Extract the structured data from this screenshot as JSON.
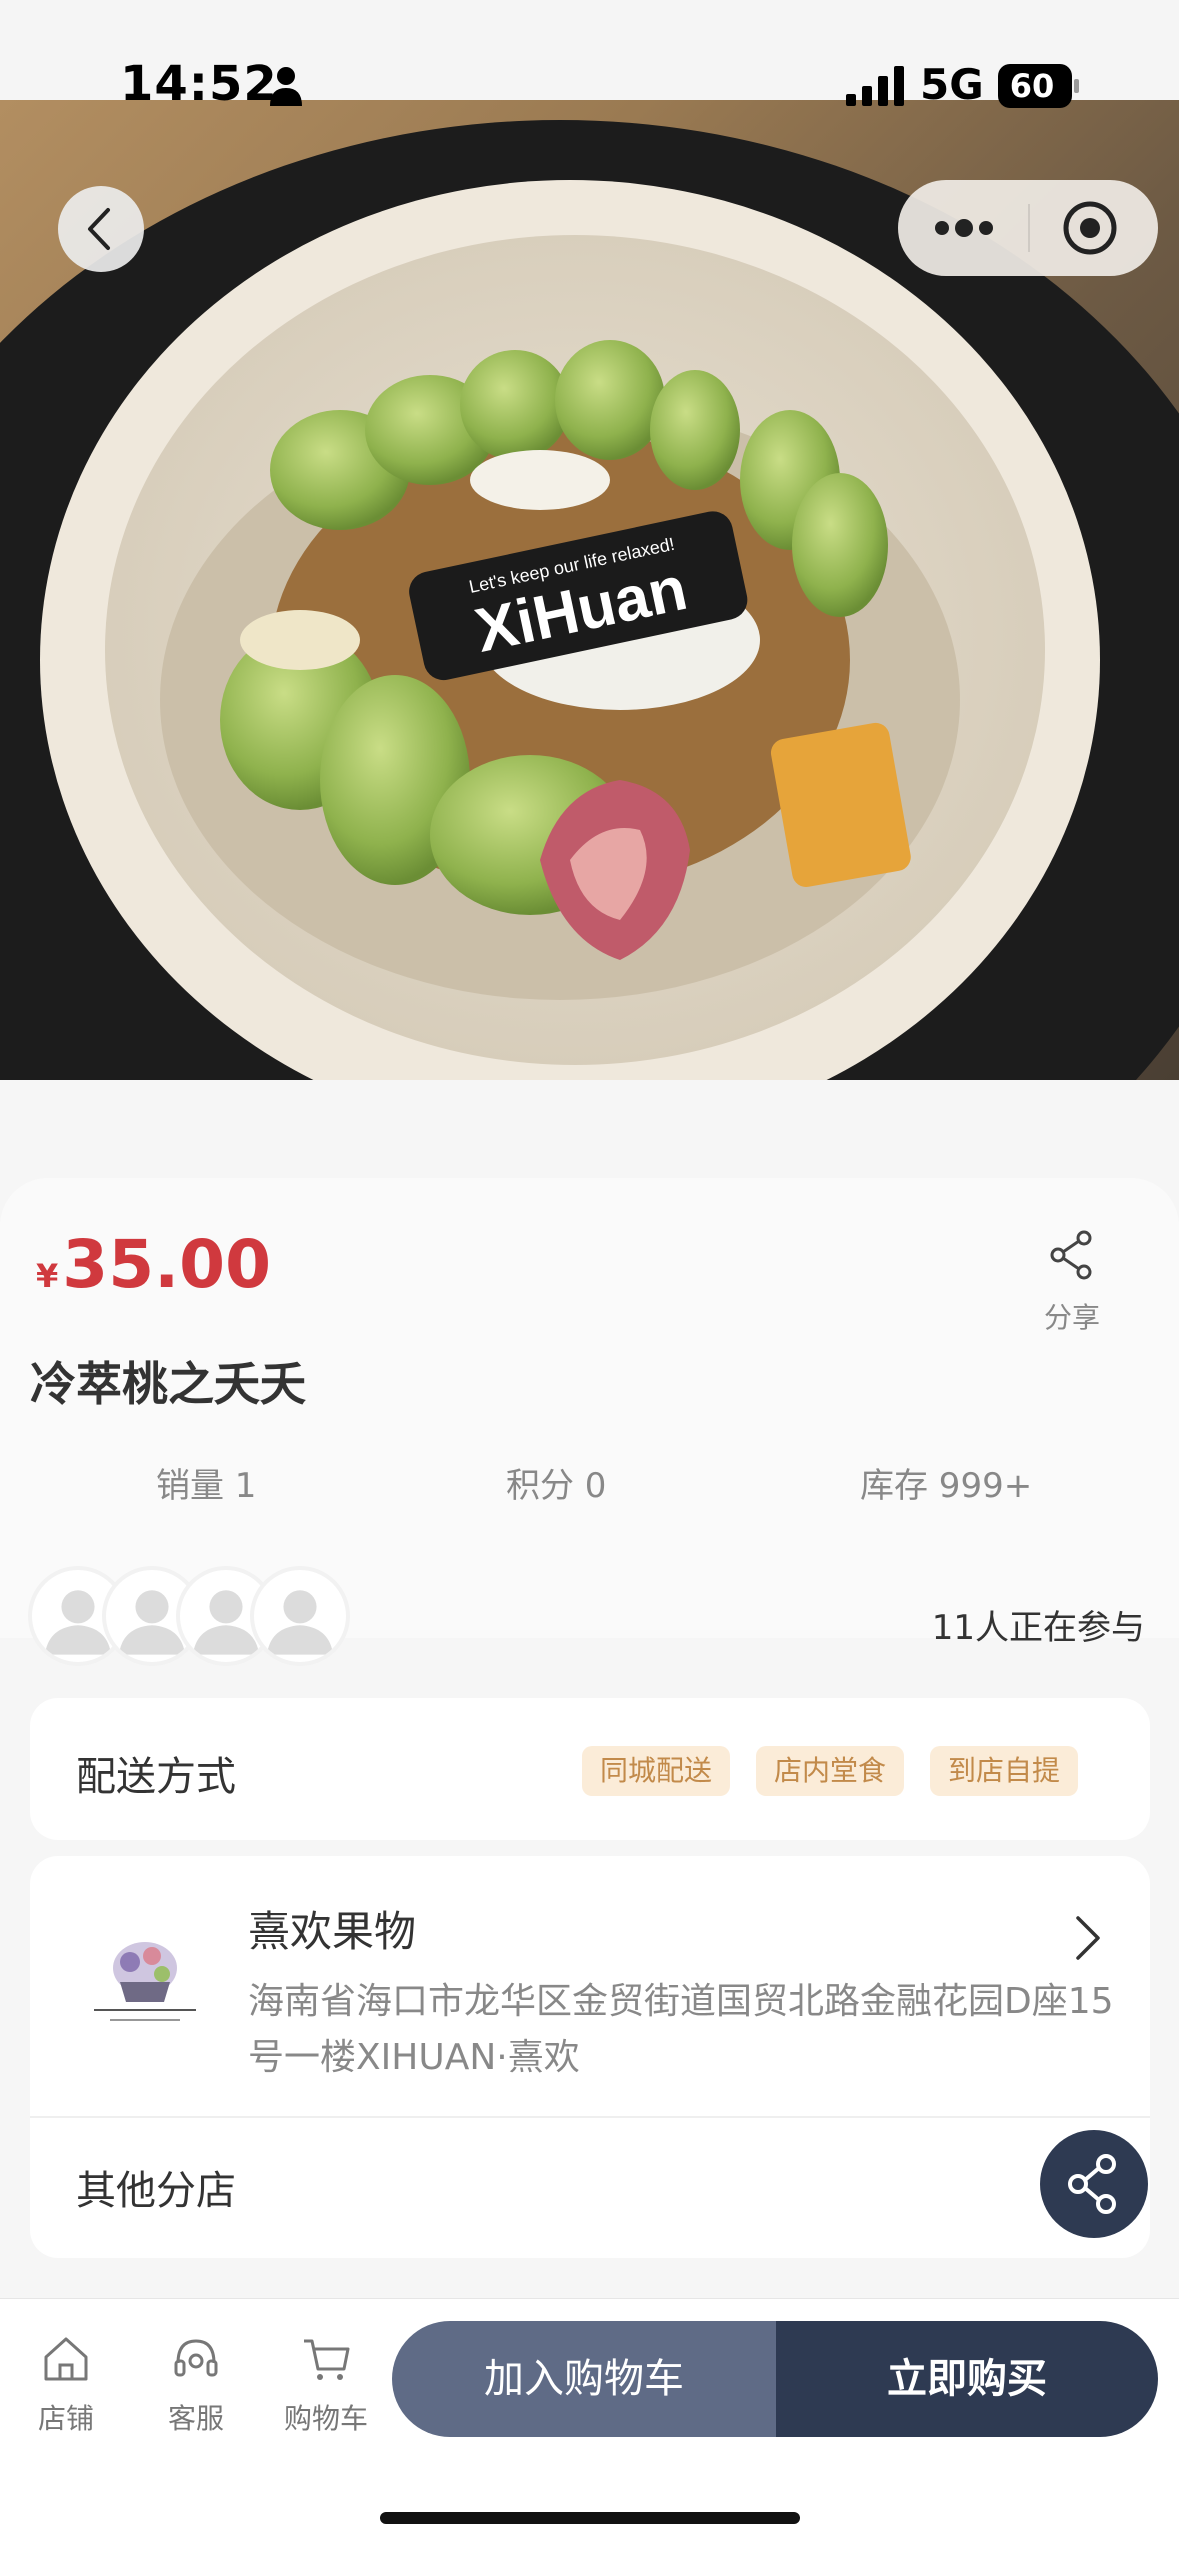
{
  "status_bar": {
    "time": "14:52",
    "network": "5G",
    "battery": "60"
  },
  "hero": {
    "image": "fruit-bowl-photo",
    "bowl_logo_text": "XiHuan",
    "bowl_logo_subtext": "Let's keep our life relaxed!"
  },
  "product": {
    "currency": "¥",
    "price": "35.00",
    "title": "冷萃桃之夭夭",
    "share_label": "分享"
  },
  "stats": {
    "sales": "销量 1",
    "points": "积分 0",
    "stock": "库存 999+"
  },
  "participants": {
    "text": "11人正在参与",
    "avatar_count": 4
  },
  "delivery": {
    "label": "配送方式",
    "tags": [
      "同城配送",
      "店内堂食",
      "到店自提"
    ],
    "tag_color": "#c28a4a",
    "tag_background": "#fbecd8"
  },
  "store": {
    "name": "熹欢果物",
    "address": "海南省海口市龙华区金贸街道国贸北路金融花园D座15号一楼XIHUAN·熹欢",
    "other_branches": "其他分店"
  },
  "bottom_nav": {
    "store": "店铺",
    "service": "客服",
    "cart": "购物车"
  },
  "actions": {
    "add_to_cart": "加入购物车",
    "buy_now": "立即购买"
  },
  "colors": {
    "price": "#d0393e",
    "primary_dark": "#2e3a52",
    "secondary": "#5f6b86"
  },
  "icons": {
    "back": "chevron-left-icon",
    "more": "more-dots-icon",
    "close": "target-circle-icon",
    "share": "share-icon",
    "store": "home-icon",
    "service": "headset-icon",
    "cart": "cart-icon"
  }
}
